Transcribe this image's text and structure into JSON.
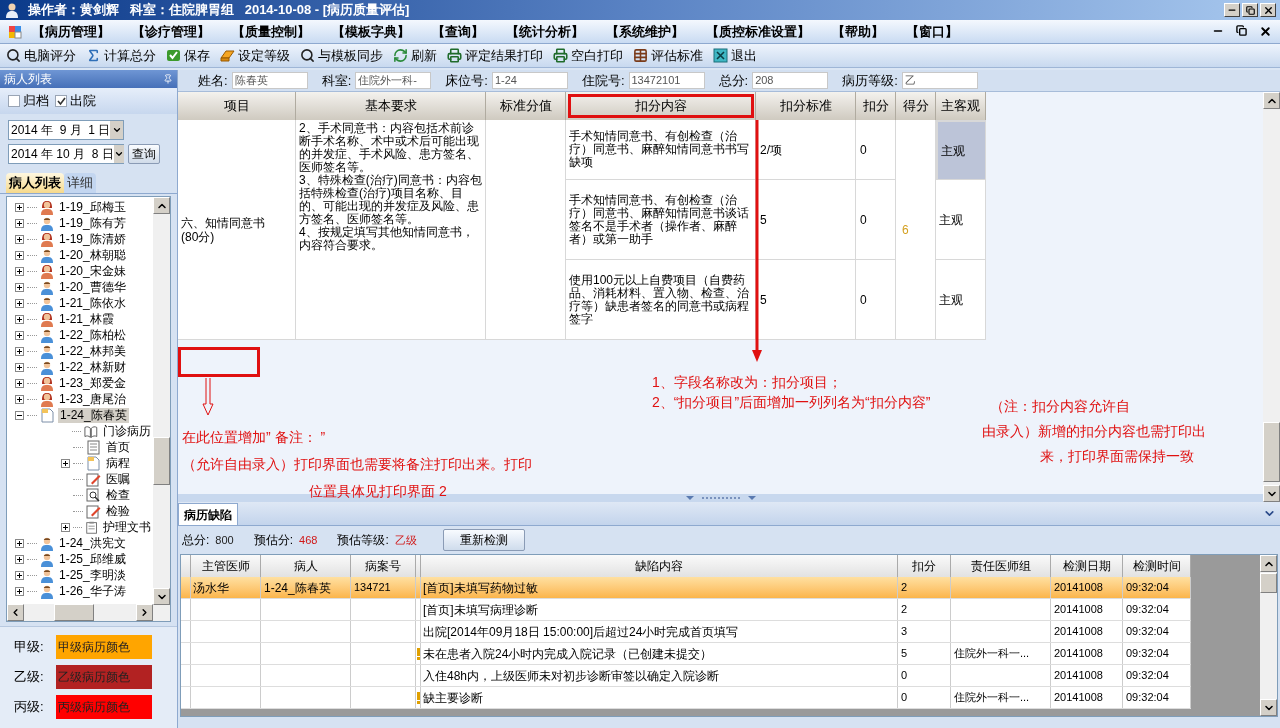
{
  "window": {
    "title": "操作者：黄剑辉   科室：住院脾胃组   2014-10-08 - [病历质量评估]"
  },
  "menu": [
    "【病历管理】",
    "【诊疗管理】",
    "【质量控制】",
    "【模板字典】",
    "【查询】",
    "【统计分析】",
    "【系统维护】",
    "【质控标准设置】",
    "【帮助】",
    "【窗口】"
  ],
  "toolbar": [
    {
      "label": "电脑评分",
      "kind": "search"
    },
    {
      "label": "计算总分",
      "kind": "sum"
    },
    {
      "label": "保存",
      "kind": "save"
    },
    {
      "label": "设定等级",
      "kind": "grade"
    },
    {
      "label": "与模板同步",
      "kind": "search"
    },
    {
      "label": "刷新",
      "kind": "refresh"
    },
    {
      "label": "评定结果打印",
      "kind": "print"
    },
    {
      "label": "空白打印",
      "kind": "print"
    },
    {
      "label": "评估标准",
      "kind": "table"
    },
    {
      "label": "退出",
      "kind": "exit"
    }
  ],
  "patient_panel": {
    "title": "病人列表",
    "filters": [
      {
        "label": "归档",
        "checked": false
      },
      {
        "label": "出院",
        "checked": true
      }
    ],
    "date_from": "2014 年  9 月  1 日",
    "date_to": "2014 年 10 月  8 日",
    "query_button": "查询",
    "tabs": [
      {
        "label": "病人列表",
        "selected": true
      },
      {
        "label": "详细",
        "selected": false
      }
    ],
    "tree": [
      {
        "label": "1-19_邱梅玉",
        "kind": "female",
        "expanded": false,
        "selected": false
      },
      {
        "label": "1-19_陈有芳",
        "kind": "male",
        "expanded": false,
        "selected": false
      },
      {
        "label": "1-19_陈清娇",
        "kind": "female",
        "expanded": false,
        "selected": false
      },
      {
        "label": "1-20_林朝聪",
        "kind": "male",
        "expanded": false,
        "selected": false
      },
      {
        "label": "1-20_宋金妹",
        "kind": "female",
        "expanded": false,
        "selected": false
      },
      {
        "label": "1-20_曹德华",
        "kind": "male",
        "expanded": false,
        "selected": false
      },
      {
        "label": "1-21_陈依水",
        "kind": "male",
        "expanded": false,
        "selected": false
      },
      {
        "label": "1-21_林霞",
        "kind": "female",
        "expanded": false,
        "selected": false
      },
      {
        "label": "1-22_陈柏松",
        "kind": "male",
        "expanded": false,
        "selected": false
      },
      {
        "label": "1-22_林邦美",
        "kind": "male",
        "expanded": false,
        "selected": false
      },
      {
        "label": "1-22_林新财",
        "kind": "male",
        "expanded": false,
        "selected": false
      },
      {
        "label": "1-23_郑爱金",
        "kind": "female",
        "expanded": false,
        "selected": false
      },
      {
        "label": "1-23_唐尾治",
        "kind": "female",
        "expanded": false,
        "selected": false
      },
      {
        "label": "1-24_陈春英",
        "kind": "record",
        "expanded": true,
        "selected": true,
        "children": [
          {
            "label": "门诊病历",
            "kind": "book",
            "selected": false
          },
          {
            "label": "首页",
            "kind": "page",
            "selected": false
          },
          {
            "label": "病程",
            "kind": "record",
            "expanded": false,
            "selected": false
          },
          {
            "label": "医嘱",
            "kind": "edit",
            "selected": false
          },
          {
            "label": "检查",
            "kind": "inspect",
            "selected": false
          },
          {
            "label": "检验",
            "kind": "edit",
            "selected": false
          },
          {
            "label": "护理文书",
            "kind": "clipboard",
            "expanded": false,
            "selected": false
          }
        ]
      },
      {
        "label": "1-24_洪宪文",
        "kind": "male",
        "expanded": false,
        "selected": false
      },
      {
        "label": "1-25_邱维威",
        "kind": "male",
        "expanded": false,
        "selected": false
      },
      {
        "label": "1-25_李明淡",
        "kind": "male",
        "expanded": false,
        "selected": false
      },
      {
        "label": "1-26_华子涛",
        "kind": "male",
        "expanded": false,
        "selected": false
      }
    ],
    "legend": [
      {
        "label": "甲级:",
        "swatch": "甲级病历颜色",
        "color": "#ffa500"
      },
      {
        "label": "乙级:",
        "swatch": "乙级病历颜色",
        "color": "#b22222"
      },
      {
        "label": "丙级:",
        "swatch": "丙级病历颜色",
        "color": "#ff0000"
      }
    ]
  },
  "record_form": [
    {
      "label": "姓名:",
      "value": "陈春英"
    },
    {
      "label": "科室:",
      "value": "住院外一科-"
    },
    {
      "label": "床位号:",
      "value": "1-24"
    },
    {
      "label": "住院号:",
      "value": "13472101"
    },
    {
      "label": "总分:",
      "value": "208"
    },
    {
      "label": "病历等级:",
      "value": "乙"
    }
  ],
  "score_table": {
    "columns": [
      {
        "label": "项目",
        "marked": false
      },
      {
        "label": "基本要求",
        "marked": false
      },
      {
        "label": "标准分值",
        "marked": false
      },
      {
        "label": "扣分内容",
        "marked": true
      },
      {
        "label": "扣分标准",
        "marked": false
      },
      {
        "label": "扣分",
        "marked": false
      },
      {
        "label": "得分",
        "marked": false
      },
      {
        "label": "主客观",
        "marked": false
      }
    ],
    "rows": [
      {
        "item": [
          "六、知情同意书",
          "(80分)"
        ],
        "requirement": [
          "2、手术同意书：内容包括术前诊断手术名称、术中或术后可能出现的并发症、手术风险、患方签名、医师签名等。",
          "3、特殊检查(治疗)同意书：内容包括特殊检查(治疗)项目名称、目的、可能出现的并发症及风险、患方签名、医师签名等。",
          "4、按规定填写其他知情同意书，内容符合要求。"
        ],
        "score": "6",
        "sub_rows": [
          {
            "content": "手术知情同意书、有创检查（治疗）同意书、麻醉知情同意书书写缺项",
            "standard": "2/项",
            "deduct": "0",
            "type": "主观",
            "selected": true
          },
          {
            "content": "手术知情同意书、有创检查（治疗）同意书、麻醉知情同意书谈话签名不是手术者（操作者、麻醉者）或第一助手",
            "standard": "5",
            "deduct": "0",
            "type": "主观",
            "selected": false
          },
          {
            "content": "使用100元以上自费项目（自费药品、消耗材料、置入物、检查、治疗等）缺患者签名的同意书或病程签字",
            "standard": "5",
            "deduct": "0",
            "type": "主观",
            "selected": false
          }
        ]
      }
    ]
  },
  "annotations": {
    "remark_note": [
      "在此位置增加” 备注： ”",
      "（允许自由录入）打印界面也需要将备注打印出来。打印",
      "位置具体见打印界面 2"
    ],
    "column_note": [
      "1、字段名称改为：扣分项目；",
      "2、“扣分项目”后面增加一列列名为“扣分内容”"
    ],
    "print_note": [
      "（注：扣分内容允许自",
      "由录入）新增的扣分内容也需打印出",
      "来，打印界面需保持一致"
    ]
  },
  "defects": {
    "tab": "病历缺陷",
    "summary": [
      {
        "label": "总分:",
        "value": "800",
        "kind": "plain"
      },
      {
        "label": "预估分:",
        "value": "468",
        "kind": "alert"
      },
      {
        "label": "预估等级:",
        "value": "乙级",
        "kind": "alert"
      }
    ],
    "recheck_button": "重新检测",
    "columns": [
      "主管医师",
      "病人",
      "病案号",
      "缺陷内容",
      "扣分",
      "责任医师组",
      "检测日期",
      "检测时间"
    ],
    "rows": [
      {
        "doctor": "汤水华",
        "patient": "1-24_陈春英",
        "case_no": "134721",
        "warning": false,
        "content": "[首页]未填写药物过敏",
        "deduct": "2",
        "date": "20141008",
        "time": "09:32:04",
        "selected": true
      },
      {
        "warning": false,
        "content": "[首页]未填写病理诊断",
        "deduct": "2",
        "date": "20141008",
        "time": "09:32:04",
        "selected": false
      },
      {
        "warning": false,
        "content": "出院[2014年09月18日 15:00:00]后超过24小时完成首页填写",
        "deduct": "3",
        "date": "20141008",
        "time": "09:32:04",
        "selected": false
      },
      {
        "warning": true,
        "content": "未在患者入院24小时内完成入院记录（已创建未提交）",
        "deduct": "5",
        "group": "住院外一科一...",
        "date": "20141008",
        "time": "09:32:04",
        "selected": false
      },
      {
        "warning": false,
        "content": "入住48h内，上级医师未对初步诊断审签以确定入院诊断",
        "deduct": "0",
        "date": "20141008",
        "time": "09:32:04",
        "selected": false
      },
      {
        "warning": true,
        "content": "缺主要诊断",
        "deduct": "0",
        "group": "住院外一科一...",
        "date": "20141008",
        "time": "09:32:04",
        "selected": false
      }
    ]
  }
}
